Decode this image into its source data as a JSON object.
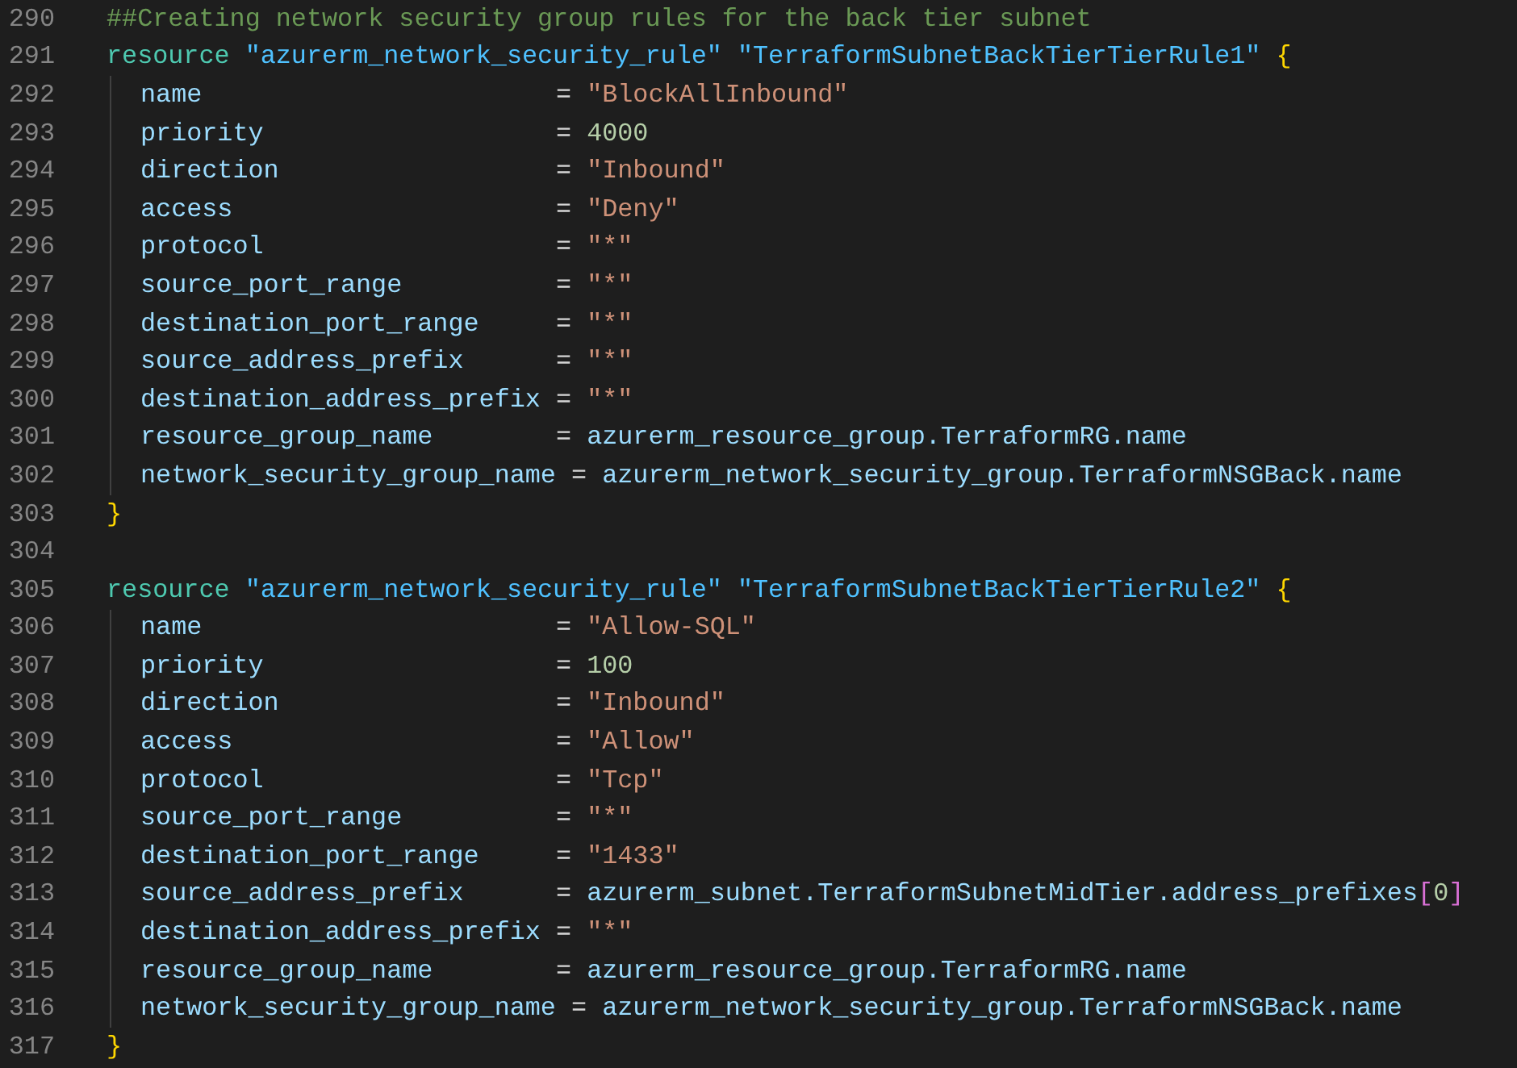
{
  "editor": {
    "lines": [
      {
        "number": "290",
        "indent_guide": false,
        "tokens": [
          {
            "kind": "comment",
            "text": "##Creating network security group rules for the back tier subnet"
          }
        ]
      },
      {
        "number": "291",
        "indent_guide": false,
        "tokens": [
          {
            "kind": "keyword",
            "text": "resource "
          },
          {
            "kind": "label",
            "text": "\"azurerm_network_security_rule\" "
          },
          {
            "kind": "label",
            "text": "\"TerraformSubnetBackTierTierRule1\" "
          },
          {
            "kind": "brace",
            "text": "{"
          }
        ]
      },
      {
        "number": "292",
        "indent_guide": true,
        "tokens": [
          {
            "kind": "attr",
            "text": "name                       "
          },
          {
            "kind": "plain",
            "text": "= "
          },
          {
            "kind": "string",
            "text": "\"BlockAllInbound\""
          }
        ]
      },
      {
        "number": "293",
        "indent_guide": true,
        "tokens": [
          {
            "kind": "attr",
            "text": "priority                   "
          },
          {
            "kind": "plain",
            "text": "= "
          },
          {
            "kind": "number",
            "text": "4000"
          }
        ]
      },
      {
        "number": "294",
        "indent_guide": true,
        "tokens": [
          {
            "kind": "attr",
            "text": "direction                  "
          },
          {
            "kind": "plain",
            "text": "= "
          },
          {
            "kind": "string",
            "text": "\"Inbound\""
          }
        ]
      },
      {
        "number": "295",
        "indent_guide": true,
        "tokens": [
          {
            "kind": "attr",
            "text": "access                     "
          },
          {
            "kind": "plain",
            "text": "= "
          },
          {
            "kind": "string",
            "text": "\"Deny\""
          }
        ]
      },
      {
        "number": "296",
        "indent_guide": true,
        "tokens": [
          {
            "kind": "attr",
            "text": "protocol                   "
          },
          {
            "kind": "plain",
            "text": "= "
          },
          {
            "kind": "string",
            "text": "\"*\""
          }
        ]
      },
      {
        "number": "297",
        "indent_guide": true,
        "tokens": [
          {
            "kind": "attr",
            "text": "source_port_range          "
          },
          {
            "kind": "plain",
            "text": "= "
          },
          {
            "kind": "string",
            "text": "\"*\""
          }
        ]
      },
      {
        "number": "298",
        "indent_guide": true,
        "tokens": [
          {
            "kind": "attr",
            "text": "destination_port_range     "
          },
          {
            "kind": "plain",
            "text": "= "
          },
          {
            "kind": "string",
            "text": "\"*\""
          }
        ]
      },
      {
        "number": "299",
        "indent_guide": true,
        "tokens": [
          {
            "kind": "attr",
            "text": "source_address_prefix      "
          },
          {
            "kind": "plain",
            "text": "= "
          },
          {
            "kind": "string",
            "text": "\"*\""
          }
        ]
      },
      {
        "number": "300",
        "indent_guide": true,
        "tokens": [
          {
            "kind": "attr",
            "text": "destination_address_prefix "
          },
          {
            "kind": "plain",
            "text": "= "
          },
          {
            "kind": "string",
            "text": "\"*\""
          }
        ]
      },
      {
        "number": "301",
        "indent_guide": true,
        "tokens": [
          {
            "kind": "attr",
            "text": "resource_group_name        "
          },
          {
            "kind": "plain",
            "text": "= "
          },
          {
            "kind": "attr",
            "text": "azurerm_resource_group.TerraformRG.name"
          }
        ]
      },
      {
        "number": "302",
        "indent_guide": true,
        "tokens": [
          {
            "kind": "attr",
            "text": "network_security_group_name "
          },
          {
            "kind": "plain",
            "text": "= "
          },
          {
            "kind": "attr",
            "text": "azurerm_network_security_group.TerraformNSGBack.name"
          }
        ]
      },
      {
        "number": "303",
        "indent_guide": false,
        "tokens": [
          {
            "kind": "brace",
            "text": "}"
          }
        ]
      },
      {
        "number": "304",
        "indent_guide": false
      },
      {
        "number": "305",
        "indent_guide": false,
        "tokens": [
          {
            "kind": "keyword",
            "text": "resource "
          },
          {
            "kind": "label",
            "text": "\"azurerm_network_security_rule\" "
          },
          {
            "kind": "label",
            "text": "\"TerraformSubnetBackTierTierRule2\" "
          },
          {
            "kind": "brace",
            "text": "{"
          }
        ]
      },
      {
        "number": "306",
        "indent_guide": true,
        "tokens": [
          {
            "kind": "attr",
            "text": "name                       "
          },
          {
            "kind": "plain",
            "text": "= "
          },
          {
            "kind": "string",
            "text": "\"Allow-SQL\""
          }
        ]
      },
      {
        "number": "307",
        "indent_guide": true,
        "tokens": [
          {
            "kind": "attr",
            "text": "priority                   "
          },
          {
            "kind": "plain",
            "text": "= "
          },
          {
            "kind": "number",
            "text": "100"
          }
        ]
      },
      {
        "number": "308",
        "indent_guide": true,
        "tokens": [
          {
            "kind": "attr",
            "text": "direction                  "
          },
          {
            "kind": "plain",
            "text": "= "
          },
          {
            "kind": "string",
            "text": "\"Inbound\""
          }
        ]
      },
      {
        "number": "309",
        "indent_guide": true,
        "tokens": [
          {
            "kind": "attr",
            "text": "access                     "
          },
          {
            "kind": "plain",
            "text": "= "
          },
          {
            "kind": "string",
            "text": "\"Allow\""
          }
        ]
      },
      {
        "number": "310",
        "indent_guide": true,
        "tokens": [
          {
            "kind": "attr",
            "text": "protocol                   "
          },
          {
            "kind": "plain",
            "text": "= "
          },
          {
            "kind": "string",
            "text": "\"Tcp\""
          }
        ]
      },
      {
        "number": "311",
        "indent_guide": true,
        "tokens": [
          {
            "kind": "attr",
            "text": "source_port_range          "
          },
          {
            "kind": "plain",
            "text": "= "
          },
          {
            "kind": "string",
            "text": "\"*\""
          }
        ]
      },
      {
        "number": "312",
        "indent_guide": true,
        "tokens": [
          {
            "kind": "attr",
            "text": "destination_port_range     "
          },
          {
            "kind": "plain",
            "text": "= "
          },
          {
            "kind": "string",
            "text": "\"1433\""
          }
        ]
      },
      {
        "number": "313",
        "indent_guide": true,
        "tokens": [
          {
            "kind": "attr",
            "text": "source_address_prefix      "
          },
          {
            "kind": "plain",
            "text": "= "
          },
          {
            "kind": "attr",
            "text": "azurerm_subnet.TerraformSubnetMidTier.address_prefixes"
          },
          {
            "kind": "bracket",
            "text": "["
          },
          {
            "kind": "number",
            "text": "0"
          },
          {
            "kind": "bracket",
            "text": "]"
          }
        ]
      },
      {
        "number": "314",
        "indent_guide": true,
        "tokens": [
          {
            "kind": "attr",
            "text": "destination_address_prefix "
          },
          {
            "kind": "plain",
            "text": "= "
          },
          {
            "kind": "string",
            "text": "\"*\""
          }
        ]
      },
      {
        "number": "315",
        "indent_guide": true,
        "tokens": [
          {
            "kind": "attr",
            "text": "resource_group_name        "
          },
          {
            "kind": "plain",
            "text": "= "
          },
          {
            "kind": "attr",
            "text": "azurerm_resource_group.TerraformRG.name"
          }
        ]
      },
      {
        "number": "316",
        "indent_guide": true,
        "tokens": [
          {
            "kind": "attr",
            "text": "network_security_group_name "
          },
          {
            "kind": "plain",
            "text": "= "
          },
          {
            "kind": "attr",
            "text": "azurerm_network_security_group.TerraformNSGBack.name"
          }
        ]
      },
      {
        "number": "317",
        "indent_guide": false,
        "tokens": [
          {
            "kind": "brace",
            "text": "}"
          }
        ]
      }
    ]
  }
}
